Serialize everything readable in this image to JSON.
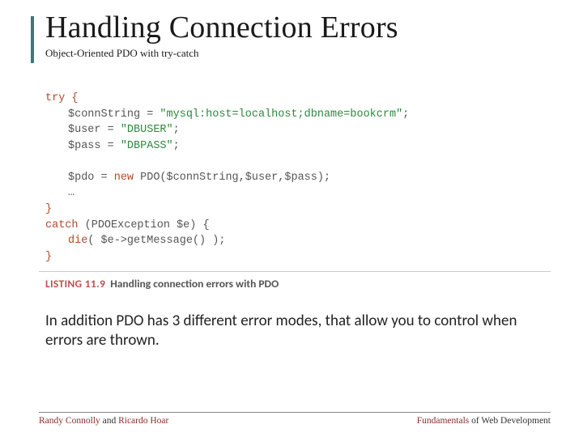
{
  "title": "Handling Connection Errors",
  "subtitle": "Object-Oriented PDO with try-catch",
  "code": {
    "l1_kw": "try",
    "l1_b": " {",
    "l2a": "$connString = ",
    "l2s": "\"mysql:host=localhost;dbname=bookcrm\"",
    "l2e": ";",
    "l3a": "$user = ",
    "l3s": "\"DBUSER\"",
    "l3e": ";",
    "l4a": "$pass = ",
    "l4s": "\"DBPASS\"",
    "l4e": ";",
    "l5a": "$pdo = ",
    "l5kw": "new",
    "l5b": " PDO($connString,$user,$pass);",
    "l6": "…",
    "l7": "}",
    "l8a": "catch",
    "l8b": " (PDOException $e) {",
    "l9a": "die",
    "l9b": "( $e->getMessage() );",
    "l10": "}"
  },
  "listing": {
    "label": "LISTING 11.9",
    "caption": "Handling connection errors with PDO"
  },
  "body": "In addition PDO has 3 different error modes, that allow you to control when errors are thrown.",
  "footer": {
    "left_a": "Randy Connolly",
    "left_mid": " and ",
    "left_b": "Ricardo Hoar",
    "right_a": "Fundamentals",
    "right_b": " of Web Development"
  }
}
